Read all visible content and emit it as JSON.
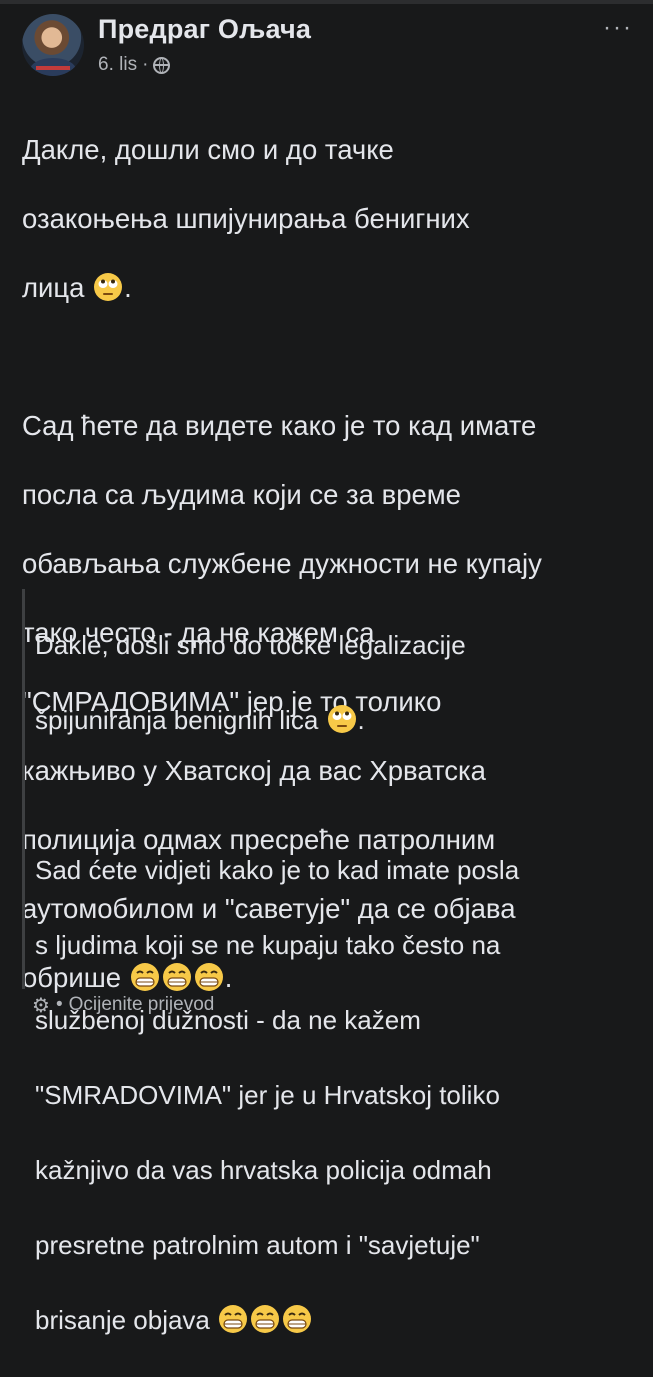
{
  "post": {
    "author_name": "Предраг Ољача",
    "timestamp": "6. lis",
    "separator": "·",
    "more_label": "···",
    "body": {
      "p1_lines": [
        "Дакле, дошли смо и до тачке",
        "озакоњења шпијунирања бенигних",
        "лица "
      ],
      "p1_tail": ".",
      "p2_lines": [
        "Сад ћете да видете како је то кад имате",
        "посла са људима који се за време",
        "обављања службене дужности не купају",
        "тако често - да не кажем са",
        "\"СМРАДОВИМА\" јер је то толико",
        "кажњиво у Хватској да вас Хрватска",
        "полиција одмах пресреће патролним",
        "аутомобилом и \"саветује\" да се објава",
        "обрише "
      ],
      "p2_tail": "."
    },
    "translation": {
      "p1_lines": [
        "Dakle, došli smo do točke legalizacije",
        "špijuniranja benignih lica "
      ],
      "p1_tail": ".",
      "p2_lines": [
        "Sad ćete vidjeti kako je to kad imate posla",
        "s ljudima koji se ne kupaju tako često na",
        "službenoj dužnosti - da ne kažem",
        "\"SMRADOVIMA\" jer je u Hrvatskoj toliko",
        "kažnjivo da vas hrvatska policija odmah",
        "presretne patrolnim autom i \"savjetuje\"",
        "brisanje objava "
      ]
    },
    "footer": {
      "separator": "•",
      "rate_translation_label": "Ocijenite prijevod"
    },
    "icons": {
      "globe": "globe-icon",
      "more": "more-dots-icon",
      "gear": "gear-icon",
      "eye_roll": "face-with-rolling-eyes-emoji",
      "grimace": "grinning-face-emoji"
    },
    "colors": {
      "background": "#18191a",
      "text": "#e4e6eb",
      "secondary": "#b0b3b8",
      "emoji": "#f7c948"
    }
  }
}
